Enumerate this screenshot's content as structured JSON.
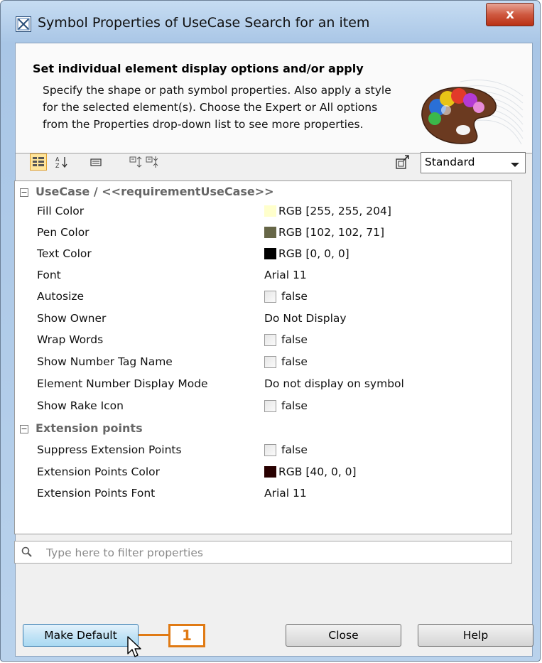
{
  "window": {
    "title": "Symbol Properties of UseCase Search for an item",
    "close_label": "x"
  },
  "header": {
    "title": "Set individual element display options and/or apply",
    "description": "Specify the shape or path symbol properties. Also apply a style for the selected element(s). Choose the Expert or All options from the Properties drop-down list to see more properties."
  },
  "toolbar": {
    "icons": [
      "categorized-view-icon",
      "sort-alphabetically-icon",
      "description-icon",
      "expand-all-icon",
      "collapse-all-icon",
      "export-icon"
    ],
    "mode_select": {
      "value": "Standard"
    }
  },
  "groups": [
    {
      "label": "UseCase / <<requirementUseCase>>",
      "rows": [
        {
          "name": "Fill Color",
          "type": "color",
          "color": "#ffffcc",
          "value": "RGB [255, 255, 204]"
        },
        {
          "name": "Pen Color",
          "type": "color",
          "color": "#666647",
          "value": "RGB [102, 102, 71]"
        },
        {
          "name": "Text Color",
          "type": "color",
          "color": "#000000",
          "value": "RGB [0, 0, 0]"
        },
        {
          "name": "Font",
          "type": "text",
          "value": "Arial 11"
        },
        {
          "name": "Autosize",
          "type": "bool",
          "value": "false"
        },
        {
          "name": "Show Owner",
          "type": "text",
          "value": "Do Not Display"
        },
        {
          "name": "Wrap Words",
          "type": "bool",
          "value": "false"
        },
        {
          "name": "Show Number Tag Name",
          "type": "bool",
          "value": "false"
        },
        {
          "name": "Element Number Display Mode",
          "type": "text",
          "value": "Do not display on symbol"
        },
        {
          "name": "Show Rake Icon",
          "type": "bool",
          "value": "false"
        }
      ]
    },
    {
      "label": "Extension points",
      "rows": [
        {
          "name": "Suppress Extension Points",
          "type": "bool",
          "value": "false"
        },
        {
          "name": "Extension Points Color",
          "type": "color",
          "color": "#280000",
          "value": "RGB [40, 0, 0]"
        },
        {
          "name": "Extension Points Font",
          "type": "text",
          "value": "Arial 11"
        }
      ]
    }
  ],
  "filter": {
    "placeholder": "Type here to filter properties"
  },
  "buttons": {
    "make_default": "Make Default",
    "close": "Close",
    "help": "Help"
  },
  "callout": {
    "label": "1",
    "color": "#e07a14"
  }
}
